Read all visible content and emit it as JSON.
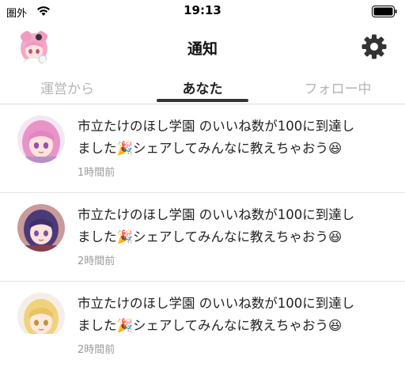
{
  "status_bar": {
    "carrier": "圏外",
    "time": "19:13"
  },
  "header": {
    "title": "通知",
    "settings_icon": "gear-icon"
  },
  "tabs": [
    {
      "label": "運営から",
      "active": false
    },
    {
      "label": "あなた",
      "active": true
    },
    {
      "label": "フォロー中",
      "active": false
    }
  ],
  "notifications": [
    {
      "line1": "市立たけのほし学園 のいいね数が100に到達し",
      "line2": "ました🎉シェアしてみんなに教えちゃおう😆",
      "time": "1時間前",
      "avatar": "pink-hair-character"
    },
    {
      "line1": "市立たけのほし学園 のいいね数が100に到達し",
      "line2": "ました🎉シェアしてみんなに教えちゃおう😆",
      "time": "2時間前",
      "avatar": "purple-hair-character"
    },
    {
      "line1": "市立たけのほし学園 のいいね数が100に到達し",
      "line2": "ました🎉シェアしてみんなに教えちゃおう😆",
      "time": "2時間前",
      "avatar": "blonde-hair-character"
    }
  ],
  "colors": {
    "active_tab": "#222222",
    "inactive_tab": "#b5b5b5",
    "divider": "#e3e3e3",
    "timestamp": "#9a9a9a"
  }
}
